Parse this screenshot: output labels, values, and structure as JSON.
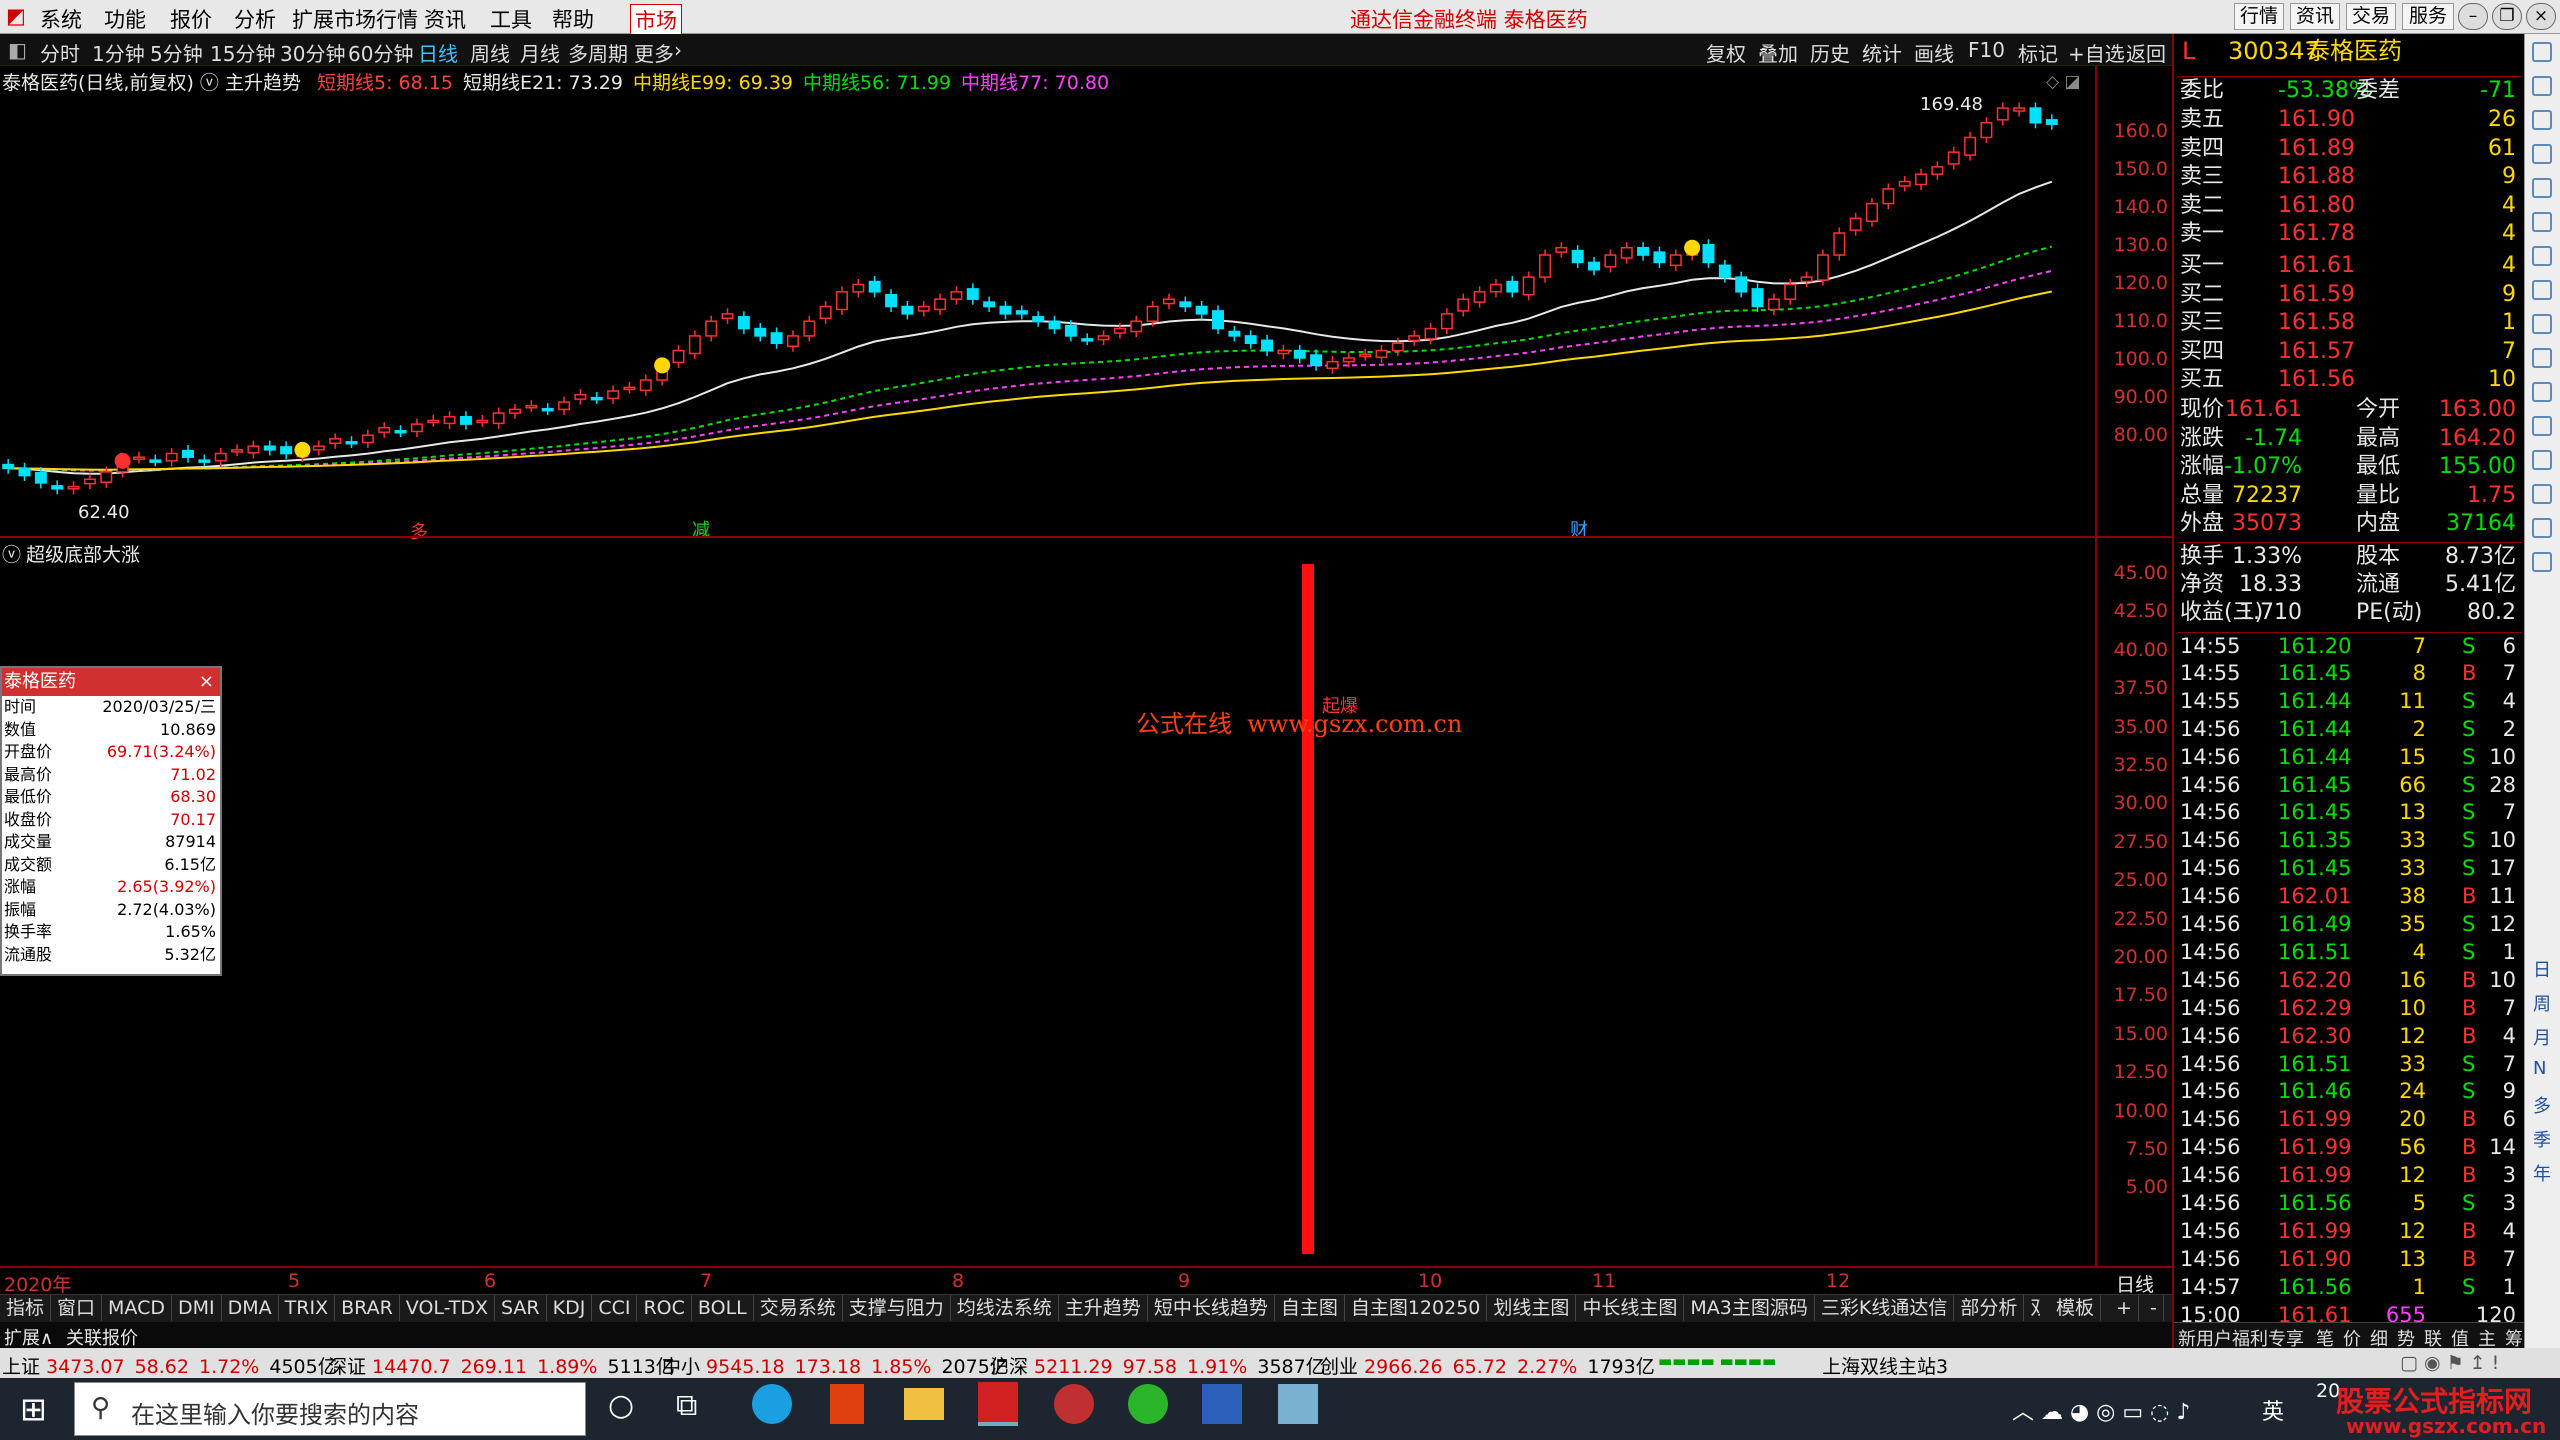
{
  "menu": {
    "items": [
      "系统",
      "功能",
      "报价",
      "分析",
      "扩展市场行情",
      "资讯",
      "工具",
      "帮助",
      "市场"
    ],
    "title": "通达信金融终端  泰格医药",
    "sys_buttons": [
      "行情",
      "资讯",
      "交易",
      "服务"
    ]
  },
  "toolbar": {
    "periods": [
      "分时",
      "1分钟",
      "5分钟",
      "15分钟",
      "30分钟",
      "60分钟",
      "日线",
      "周线",
      "月线",
      "多周期",
      "更多"
    ],
    "right": [
      "复权",
      "叠加",
      "历史",
      "统计",
      "画线",
      "F10",
      "标记",
      "+自选",
      "返回"
    ]
  },
  "main": {
    "title": "泰格医药(日线,前复权)",
    "indicator": "主升趋势",
    "ma_labels": [
      {
        "text": "短期线5: 68.15",
        "color": "#ff4040"
      },
      {
        "text": "短期线E21: 73.29",
        "color": "#e8e8e8"
      },
      {
        "text": "中期线E99: 69.39",
        "color": "#ffd800"
      },
      {
        "text": "中期线56: 71.99",
        "color": "#00e000"
      },
      {
        "text": "中期线77: 70.80",
        "color": "#ff40ff"
      }
    ],
    "high_label": "169.48",
    "low_label": "62.40",
    "yaxis": [
      "160.0",
      "150.0",
      "140.0",
      "130.0",
      "120.0",
      "110.0",
      "100.0",
      "90.00",
      "80.00"
    ],
    "markers": [
      {
        "text": "多",
        "color": "#ff3030"
      },
      {
        "text": "减",
        "color": "#00e000"
      },
      {
        "text": "财",
        "color": "#40a0ff"
      }
    ]
  },
  "sub": {
    "title": "超级底部大涨",
    "signal_label": "起爆",
    "yaxis": [
      "45.00",
      "42.50",
      "40.00",
      "37.50",
      "35.00",
      "32.50",
      "30.00",
      "27.50",
      "25.00",
      "22.50",
      "20.00",
      "17.50",
      "15.00",
      "12.50",
      "10.00",
      "7.50",
      "5.00"
    ],
    "watermark": "公式在线  www.gszx.com.cn"
  },
  "infobox": {
    "title": "泰格医药",
    "rows": [
      {
        "k": "时间",
        "v": "2020/03/25/三",
        "c": "#000"
      },
      {
        "k": "数值",
        "v": "10.869",
        "c": "#000"
      },
      {
        "k": "开盘价",
        "v": "69.71(3.24%)",
        "c": "#d00000"
      },
      {
        "k": "最高价",
        "v": "71.02",
        "c": "#d00000"
      },
      {
        "k": "最低价",
        "v": "68.30",
        "c": "#d00000"
      },
      {
        "k": "收盘价",
        "v": "70.17",
        "c": "#d00000"
      },
      {
        "k": "成交量",
        "v": "87914",
        "c": "#000"
      },
      {
        "k": "成交额",
        "v": "6.15亿",
        "c": "#000"
      },
      {
        "k": "涨幅",
        "v": "2.65(3.92%)",
        "c": "#d00000"
      },
      {
        "k": "振幅",
        "v": "2.72(4.03%)",
        "c": "#000"
      },
      {
        "k": "换手率",
        "v": "1.65%",
        "c": "#000"
      },
      {
        "k": "流通股",
        "v": "5.32亿",
        "c": "#000"
      }
    ]
  },
  "dateaxis": {
    "labels": [
      "2020年",
      "5",
      "6",
      "7",
      "8",
      "9",
      "10",
      "11",
      "12"
    ],
    "right": "日线"
  },
  "tabs": [
    "指标",
    "窗口",
    "MACD",
    "DMI",
    "DMA",
    "TRIX",
    "BRAR",
    "VOL-TDX",
    "SAR",
    "KDJ",
    "CCI",
    "ROC",
    "BOLL",
    "交易系统",
    "支撑与阻力",
    "均线法系统",
    "主升趋势",
    "短中长线趋势",
    "自主图",
    "自主图120250",
    "划线主图",
    "中长线主图",
    "MA3主图源码",
    "三彩K线通达信",
    "部分析",
    "双均包络线"
  ],
  "tabs_right": [
    "模板",
    "+",
    "-"
  ],
  "ext": [
    "扩展∧",
    "关联报价"
  ],
  "quote": {
    "code": "300347",
    "name": "泰格医药",
    "prefix": "L",
    "weibi": {
      "label": "委比",
      "value": "-53.38%",
      "label2": "委差",
      "value2": "-71"
    },
    "sells": [
      {
        "l": "卖五",
        "p": "161.90",
        "v": "26"
      },
      {
        "l": "卖四",
        "p": "161.89",
        "v": "61"
      },
      {
        "l": "卖三",
        "p": "161.88",
        "v": "9"
      },
      {
        "l": "卖二",
        "p": "161.80",
        "v": "4"
      },
      {
        "l": "卖一",
        "p": "161.78",
        "v": "4"
      }
    ],
    "buys": [
      {
        "l": "买一",
        "p": "161.61",
        "v": "4"
      },
      {
        "l": "买二",
        "p": "161.59",
        "v": "9"
      },
      {
        "l": "买三",
        "p": "161.58",
        "v": "1"
      },
      {
        "l": "买四",
        "p": "161.57",
        "v": "7"
      },
      {
        "l": "买五",
        "p": "161.56",
        "v": "10"
      }
    ],
    "stats": [
      {
        "a": "现价",
        "av": "161.61",
        "ac": "#ff3030",
        "b": "今开",
        "bv": "163.00",
        "bc": "#ff3030"
      },
      {
        "a": "涨跌",
        "av": "-1.74",
        "ac": "#00e000",
        "b": "最高",
        "bv": "164.20",
        "bc": "#ff3030"
      },
      {
        "a": "涨幅",
        "av": "-1.07%",
        "ac": "#00e000",
        "b": "最低",
        "bv": "155.00",
        "bc": "#00e000"
      },
      {
        "a": "总量",
        "av": "72237",
        "ac": "#ffd800",
        "b": "量比",
        "bv": "1.75",
        "bc": "#ff3030"
      },
      {
        "a": "外盘",
        "av": "35073",
        "ac": "#ff3030",
        "b": "内盘",
        "bv": "37164",
        "bc": "#00e000"
      }
    ],
    "stats2": [
      {
        "a": "换手",
        "av": "1.33%",
        "b": "股本",
        "bv": "8.73亿"
      },
      {
        "a": "净资",
        "av": "18.33",
        "b": "流通",
        "bv": "5.41亿"
      },
      {
        "a": "收益(三)",
        "av": "1.710",
        "b": "PE(动)",
        "bv": "80.2"
      }
    ],
    "ticks": [
      {
        "t": "14:55",
        "p": "161.20",
        "v": "7",
        "s": "S",
        "n": "6"
      },
      {
        "t": "14:55",
        "p": "161.45",
        "v": "8",
        "s": "B",
        "n": "7"
      },
      {
        "t": "14:55",
        "p": "161.44",
        "v": "11",
        "s": "S",
        "n": "4"
      },
      {
        "t": "14:56",
        "p": "161.44",
        "v": "2",
        "s": "S",
        "n": "2"
      },
      {
        "t": "14:56",
        "p": "161.44",
        "v": "15",
        "s": "S",
        "n": "10"
      },
      {
        "t": "14:56",
        "p": "161.45",
        "v": "66",
        "s": "S",
        "n": "28"
      },
      {
        "t": "14:56",
        "p": "161.45",
        "v": "13",
        "s": "S",
        "n": "7"
      },
      {
        "t": "14:56",
        "p": "161.35",
        "v": "33",
        "s": "S",
        "n": "10"
      },
      {
        "t": "14:56",
        "p": "161.45",
        "v": "33",
        "s": "S",
        "n": "17"
      },
      {
        "t": "14:56",
        "p": "162.01",
        "v": "38",
        "s": "B",
        "n": "11"
      },
      {
        "t": "14:56",
        "p": "161.49",
        "v": "35",
        "s": "S",
        "n": "12"
      },
      {
        "t": "14:56",
        "p": "161.51",
        "v": "4",
        "s": "S",
        "n": "1"
      },
      {
        "t": "14:56",
        "p": "162.20",
        "v": "16",
        "s": "B",
        "n": "10"
      },
      {
        "t": "14:56",
        "p": "162.29",
        "v": "10",
        "s": "B",
        "n": "7"
      },
      {
        "t": "14:56",
        "p": "162.30",
        "v": "12",
        "s": "B",
        "n": "4"
      },
      {
        "t": "14:56",
        "p": "161.51",
        "v": "33",
        "s": "S",
        "n": "7"
      },
      {
        "t": "14:56",
        "p": "161.46",
        "v": "24",
        "s": "S",
        "n": "9"
      },
      {
        "t": "14:56",
        "p": "161.99",
        "v": "20",
        "s": "B",
        "n": "6"
      },
      {
        "t": "14:56",
        "p": "161.99",
        "v": "56",
        "s": "B",
        "n": "14"
      },
      {
        "t": "14:56",
        "p": "161.99",
        "v": "12",
        "s": "B",
        "n": "3"
      },
      {
        "t": "14:56",
        "p": "161.56",
        "v": "5",
        "s": "S",
        "n": "3"
      },
      {
        "t": "14:56",
        "p": "161.99",
        "v": "12",
        "s": "B",
        "n": "4"
      },
      {
        "t": "14:56",
        "p": "161.90",
        "v": "13",
        "s": "B",
        "n": "7"
      },
      {
        "t": "14:57",
        "p": "161.56",
        "v": "1",
        "s": "S",
        "n": "1"
      },
      {
        "t": "15:00",
        "p": "161.61",
        "v": "655",
        "s": "",
        "n": "120"
      }
    ],
    "bottom_tabs": [
      "笔",
      "价",
      "细",
      "势",
      "联",
      "值",
      "主",
      "筹"
    ],
    "promo": "新用户福利专享"
  },
  "status": {
    "items": [
      {
        "k": "上证",
        "v": "3473.07",
        "c": "58.62",
        "p": "1.72%",
        "a": "4505亿"
      },
      {
        "k": "深证",
        "v": "14470.7",
        "c": "269.11",
        "p": "1.89%",
        "a": "5113亿"
      },
      {
        "k": "中小",
        "v": "9545.18",
        "c": "173.18",
        "p": "1.85%",
        "a": "2075亿"
      },
      {
        "k": "沪深",
        "v": "5211.29",
        "c": "97.58",
        "p": "1.91%",
        "a": "3587亿"
      },
      {
        "k": "创业",
        "v": "2966.26",
        "c": "65.72",
        "p": "2.27%",
        "a": "1793亿"
      }
    ],
    "server": "上海双线主站3"
  },
  "taskbar": {
    "search_placeholder": "在这里输入你要搜索的内容",
    "ime": "英",
    "brand": "股票公式指标网",
    "brand_url": "www.gszx.com.cn",
    "clock": "20"
  },
  "right_strip": [
    "日",
    "周",
    "月",
    "N",
    "多",
    "季",
    "年"
  ],
  "chart_data": {
    "type": "candlestick",
    "title": "泰格医药(日线,前复权)",
    "ylim": [
      55,
      172
    ],
    "close": [
      68,
      66,
      64,
      62.4,
      63,
      65,
      67,
      70,
      71,
      70,
      72,
      71,
      70,
      72,
      73,
      74,
      73,
      72,
      73,
      74,
      76,
      75,
      77,
      79,
      78,
      80,
      81,
      82,
      80,
      81,
      83,
      84,
      85,
      84,
      86,
      88,
      87,
      89,
      90,
      92,
      96,
      100,
      104,
      108,
      110,
      106,
      104,
      102,
      104,
      108,
      112,
      116,
      118,
      116,
      112,
      110,
      112,
      114,
      116,
      114,
      112,
      110,
      110,
      108,
      106,
      104,
      103,
      104,
      106,
      108,
      112,
      114,
      112,
      110,
      106,
      104,
      102,
      100,
      100,
      98,
      96,
      97,
      98,
      99,
      100,
      102,
      104,
      106,
      110,
      114,
      116,
      118,
      116,
      120,
      126,
      128,
      124,
      122,
      126,
      128,
      126,
      124,
      126,
      128,
      124,
      120,
      116,
      112,
      114,
      118,
      120,
      126,
      132,
      136,
      140,
      144,
      146,
      148,
      150,
      154,
      158,
      162,
      166,
      166,
      162,
      161.6
    ],
    "ma_series": [
      {
        "name": "短期线E21",
        "color": "#e8e8e8"
      },
      {
        "name": "中期线56",
        "color": "#00e000"
      },
      {
        "name": "中期线77",
        "color": "#ff40ff"
      },
      {
        "name": "中期线E99",
        "color": "#ffd800"
      }
    ],
    "sub_signal": {
      "type": "bar",
      "value": 45,
      "label": "起爆"
    }
  },
  "colors": {
    "up": "#ff3030",
    "down": "#00e0ff",
    "axis": "#8b0000",
    "bg": "#000000"
  }
}
